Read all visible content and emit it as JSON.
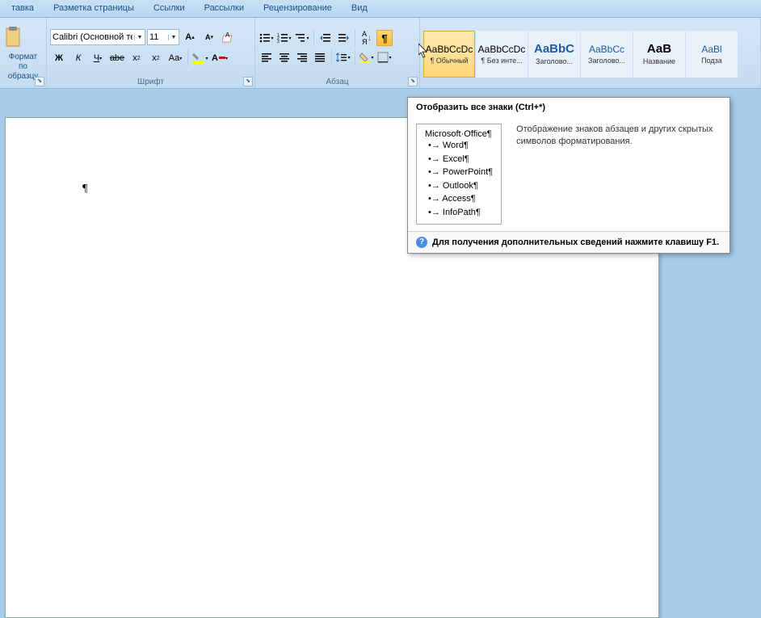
{
  "tabs": [
    "тавка",
    "Разметка страницы",
    "Ссылки",
    "Рассылки",
    "Рецензирование",
    "Вид"
  ],
  "clipboard": {
    "paste": "",
    "format_painter": "Формат по образцу"
  },
  "font": {
    "name": "Calibri (Основной те",
    "size": "11",
    "label": "Шрифт"
  },
  "paragraph": {
    "label": "Абзац"
  },
  "styles": {
    "items": [
      {
        "preview": "AaBbCcDc",
        "name": "¶ Обычный",
        "cls": ""
      },
      {
        "preview": "AaBbCcDc",
        "name": "¶ Без инте...",
        "cls": ""
      },
      {
        "preview": "AaBbC",
        "name": "Заголово...",
        "cls": "blue big"
      },
      {
        "preview": "AaBbCc",
        "name": "Заголово...",
        "cls": "blue"
      },
      {
        "preview": "АаВ",
        "name": "Название",
        "cls": "big"
      },
      {
        "preview": "AaBl",
        "name": "Подза",
        "cls": "blue"
      }
    ]
  },
  "document": {
    "content": "¶"
  },
  "tooltip": {
    "title": "Отобразить все знаки (Ctrl+*)",
    "preview_head": "Microsoft·Office¶",
    "preview_items": [
      "Word¶",
      "Excel¶",
      "PowerPoint¶",
      "Outlook¶",
      "Access¶",
      "InfoPath¶"
    ],
    "desc": "Отображение знаков абзацев и других скрытых символов форматирования.",
    "help": "Для получения дополнительных сведений нажмите клавишу F1."
  }
}
